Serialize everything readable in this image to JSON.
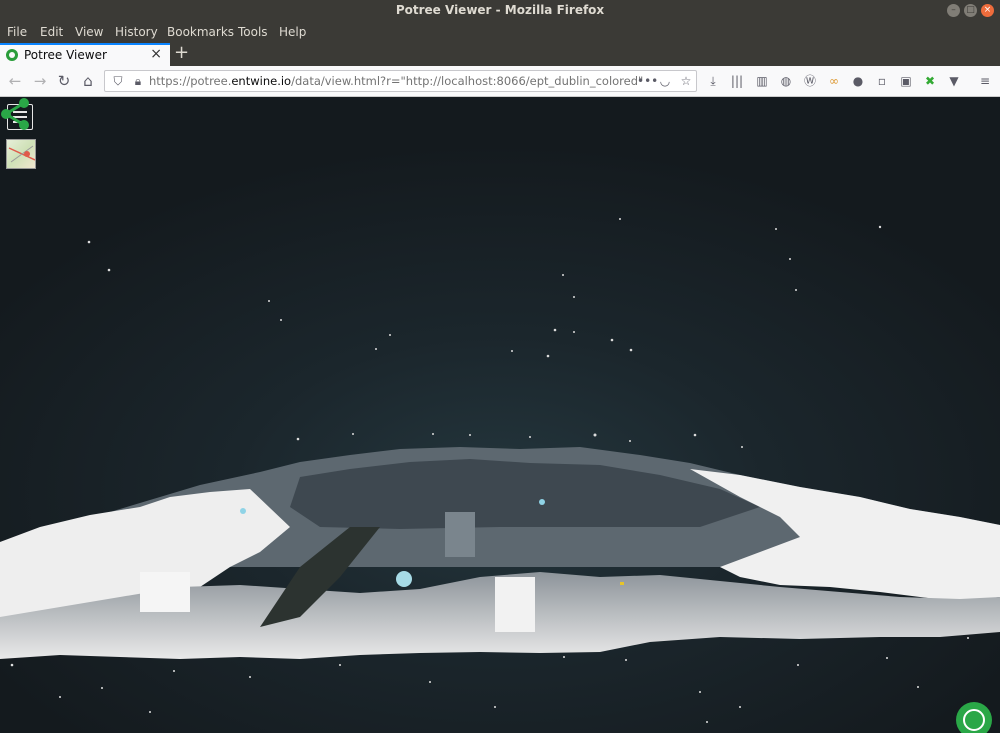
{
  "window": {
    "title": "Potree Viewer - Mozilla Firefox"
  },
  "menubar": {
    "items": [
      "File",
      "Edit",
      "View",
      "History",
      "Bookmarks",
      "Tools",
      "Help"
    ]
  },
  "tab": {
    "label": "Potree Viewer"
  },
  "address": {
    "origin_prefix": "https://potree.",
    "origin_domain": "entwine.io",
    "path": "/data/view.html?r=\"http://localhost:8066/ept_dublin_colored\""
  },
  "icons": {
    "back": "back-arrow-icon",
    "forward": "forward-arrow-icon",
    "reload": "reload-icon",
    "home": "home-icon",
    "shield": "shield-icon",
    "lock": "lock-icon",
    "page-actions": "more-dots-icon",
    "pocket": "pocket-icon",
    "bookmark": "star-icon",
    "menu": "hamburger-icon",
    "share": "share-icon",
    "potree": "potree-logo"
  },
  "colors": {
    "accent": "#0a84ff",
    "brand_green": "#2aa747",
    "titlebar": "#3b3a36"
  }
}
